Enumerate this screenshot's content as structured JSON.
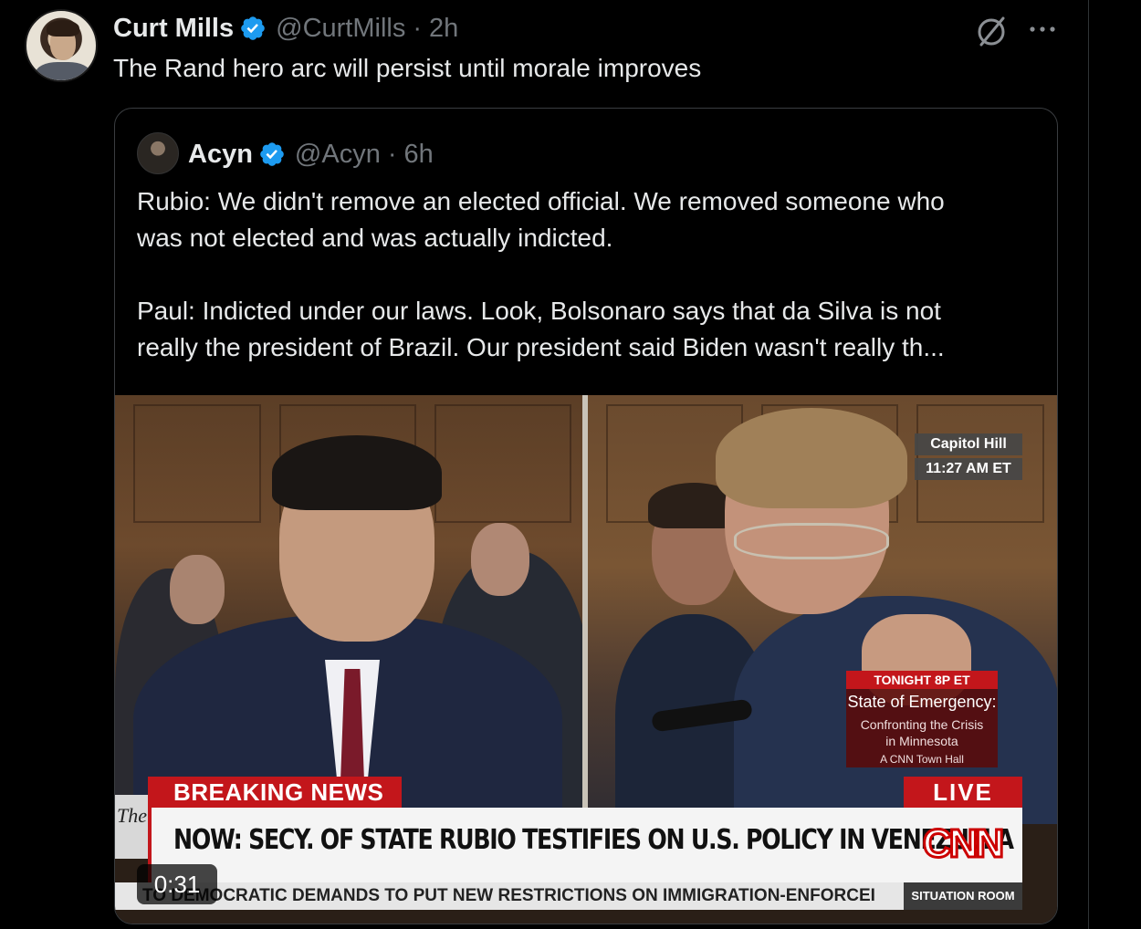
{
  "tweet": {
    "author_name": "Curt Mills",
    "handle": "@CurtMills",
    "time": "· 2h",
    "text": "The Rand hero arc will persist until morale improves",
    "avatar_icon": "user-avatar",
    "verified_color": "#1d9bf0"
  },
  "quoted": {
    "author_name": "Acyn",
    "handle": "@Acyn",
    "time": "· 6h",
    "paragraph1_line1": "Rubio: We didn't remove an elected official. We removed someone who",
    "paragraph1_line2": "was not elected and was actually indicted.",
    "paragraph2_line1": "Paul: Indicted under our laws. Look, Bolsonaro says that da Silva is not",
    "paragraph2_line2": "really the president of Brazil. Our president said Biden wasn't really th..."
  },
  "video": {
    "location": "Capitol Hill",
    "time": "11:27 AM ET",
    "tonight_tag": "TONIGHT 8P ET",
    "tonight_title": "State of Emergency:",
    "tonight_sub1": "Confronting the Crisis",
    "tonight_sub2": "in Minnesota",
    "tonight_foot": "A CNN Town Hall",
    "breaking": "BREAKING NEWS",
    "live": "LIVE",
    "the_stub": "The",
    "headline": "NOW: SECY. OF STATE RUBIO TESTIFIES ON U.S. POLICY IN VENEZUELA",
    "logo_text": "CNN",
    "ticker": "TO DEMOCRATIC DEMANDS TO PUT NEW RESTRICTIONS ON IMMIGRATION-ENFORCEI",
    "ticker_brand": "SITUATION ROOM",
    "duration": "0:31",
    "accent_red": "#c3161b"
  }
}
